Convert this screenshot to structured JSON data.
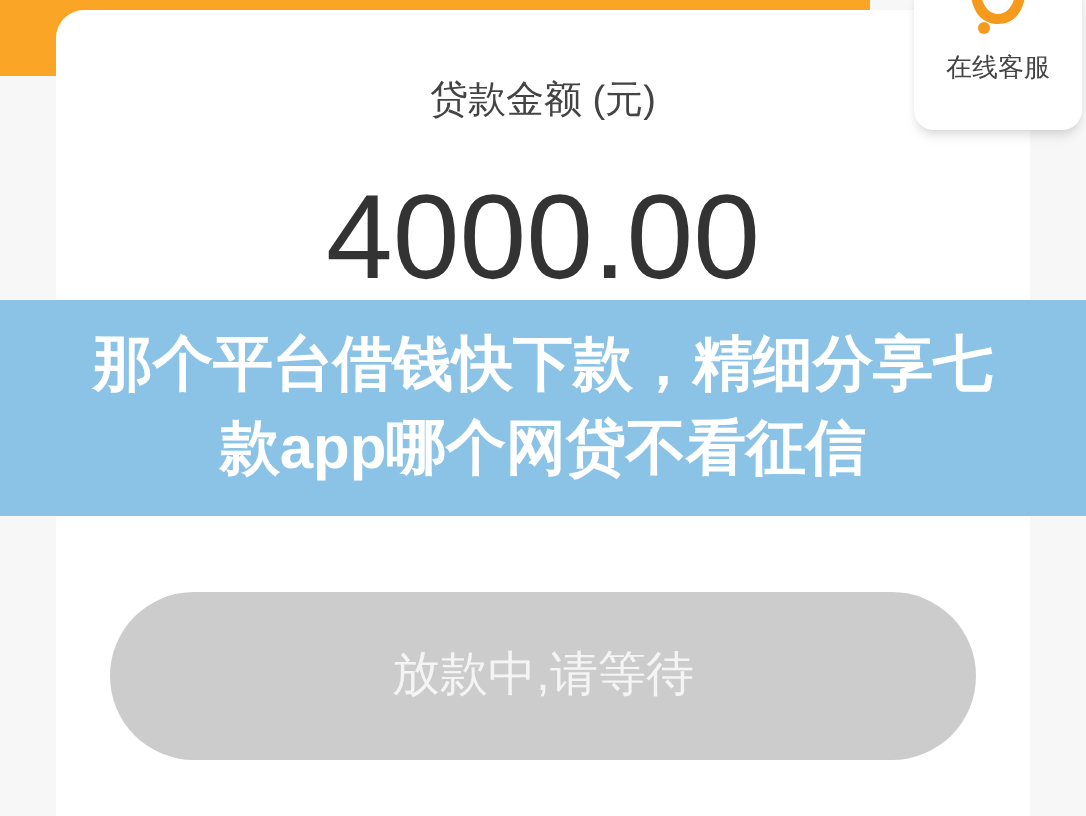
{
  "support": {
    "label": "在线客服"
  },
  "loan": {
    "label": "贷款金额 (元)",
    "amount": "4000.00"
  },
  "banner": {
    "title": "那个平台借钱快下款，精细分享七款app哪个网贷不看征信"
  },
  "button": {
    "label": "放款中,请等待",
    "disabled": true
  }
}
